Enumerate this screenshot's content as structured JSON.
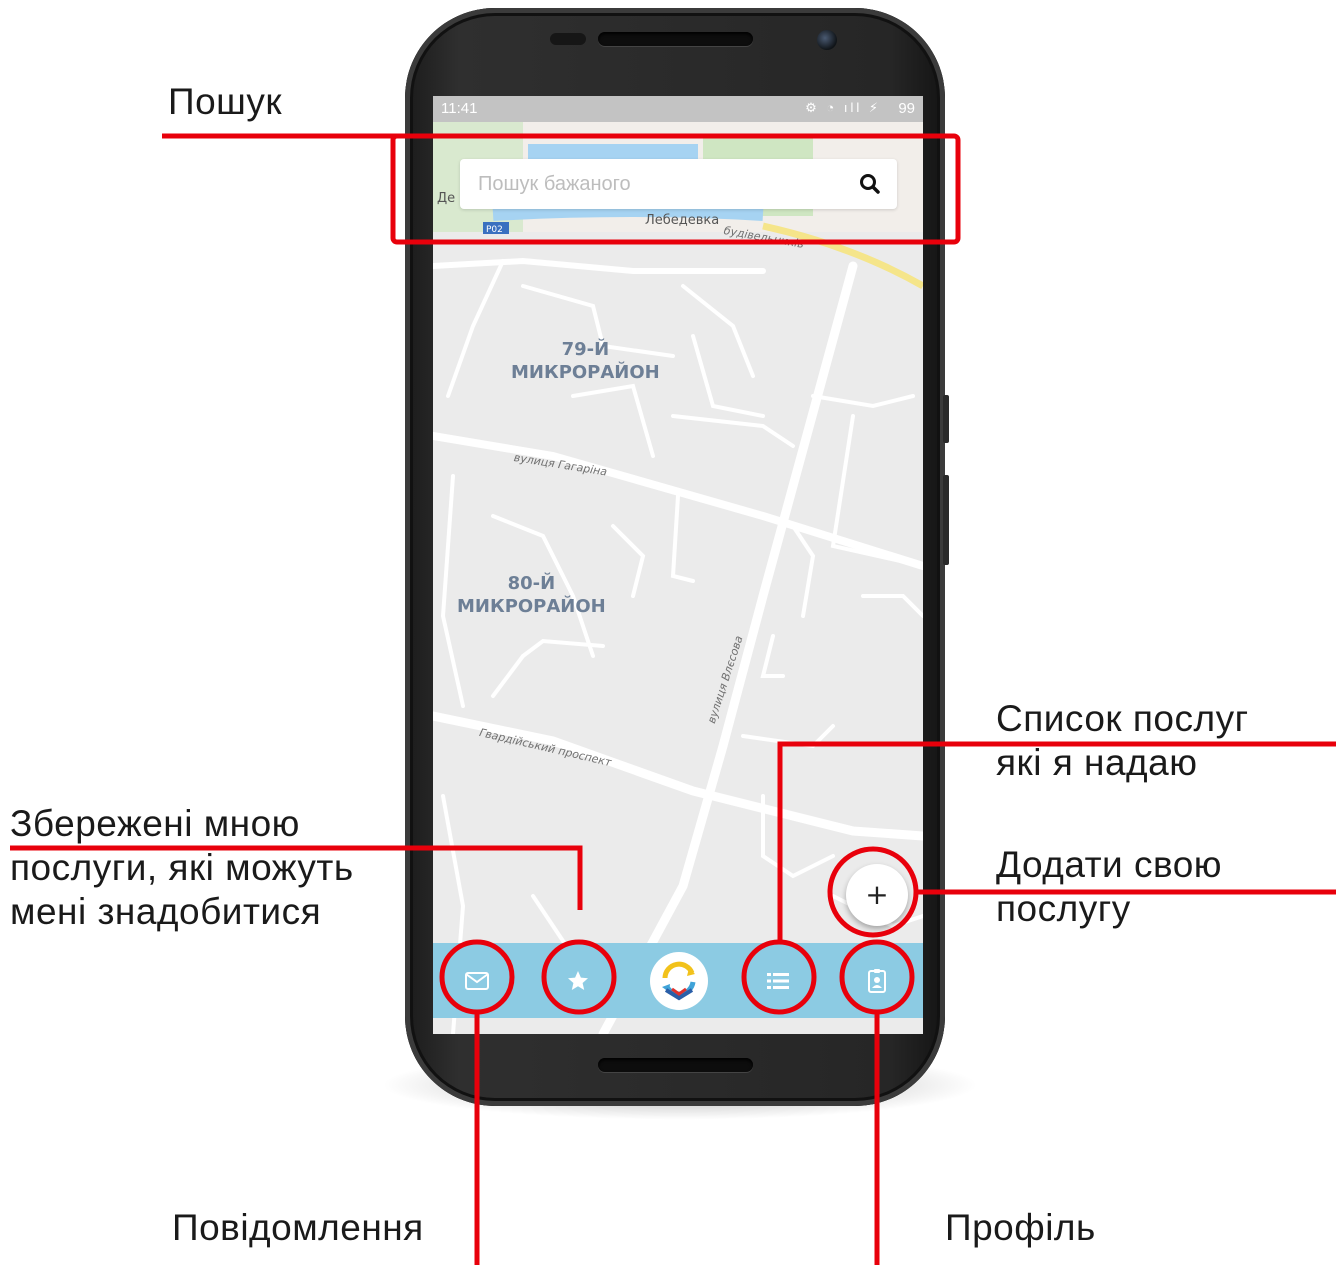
{
  "annotations": {
    "search": "Пошук",
    "saved_line1": "Збережені мною",
    "saved_line2": "послуги, які можуть",
    "saved_line3": "мені знадобитися",
    "my_services_line1": "Список послуг",
    "my_services_line2": "які я надаю",
    "add_service_line1": "Додати свою",
    "add_service_line2": "послугу",
    "messages": "Повідомлення",
    "profile": "Профіль"
  },
  "statusbar": {
    "time": "11:41",
    "battery": "99"
  },
  "search": {
    "placeholder": "Пошук бажаного"
  },
  "map": {
    "labels": {
      "district_79_line1": "79-Й",
      "district_79_line2": "МИКРОРАЙОН",
      "district_80_line1": "80-Й",
      "district_80_line2": "МИКРОРАЙОН",
      "street_gagarina": "вулиця Гагаріна",
      "street_vlesova": "вулиця Влєсова",
      "street_gvardiiskyi": "Гвардійський проспект",
      "street_budivelnykiv": "будівельників",
      "lebedevka": "Лебедевка",
      "de_fragment": "Де",
      "road_badge": "P02"
    }
  },
  "fab": {
    "label": "+"
  },
  "tabbar": {
    "items": [
      "messages",
      "saved",
      "home",
      "my-services",
      "profile"
    ]
  },
  "colors": {
    "callout_red": "#e8000b",
    "tabbar_blue": "#8ccbe3",
    "map_bg": "#ebebeb",
    "water": "#a6d3f2",
    "park": "#cfe6c2",
    "highway": "#f5e58a"
  }
}
